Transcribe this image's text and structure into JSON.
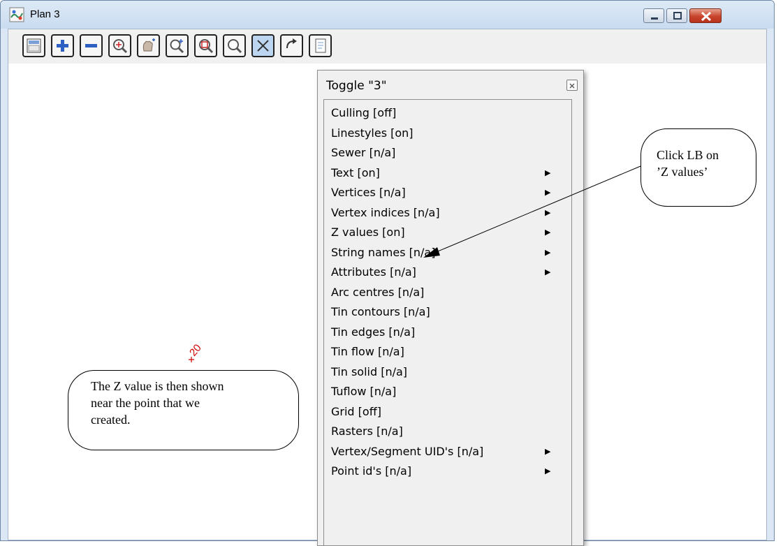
{
  "window": {
    "title": "Plan 3"
  },
  "toolbar": {
    "buttons": [
      "layout-icon",
      "zoom-in-plus-icon",
      "zoom-out-minus-icon",
      "zoom-extent-icon",
      "pan-hand-icon",
      "zoom-plus-icon",
      "zoom-window-icon",
      "zoom-search-icon",
      "toggle-icon",
      "undo-icon",
      "page-icon"
    ]
  },
  "canvas": {
    "point_label": "20"
  },
  "popup": {
    "title": "Toggle \"3\"",
    "items": [
      {
        "label": "Culling [off]",
        "submenu": false
      },
      {
        "label": "Linestyles [on]",
        "submenu": false
      },
      {
        "label": "Sewer [n/a]",
        "submenu": false
      },
      {
        "label": "Text [on]",
        "submenu": true
      },
      {
        "label": "Vertices [n/a]",
        "submenu": true
      },
      {
        "label": "Vertex indices [n/a]",
        "submenu": true
      },
      {
        "label": "Z values [on]",
        "submenu": true
      },
      {
        "label": "String names [n/a]",
        "submenu": true
      },
      {
        "label": "Attributes [n/a]",
        "submenu": true
      },
      {
        "label": "Arc centres [n/a]",
        "submenu": false
      },
      {
        "label": "Tin contours [n/a]",
        "submenu": false
      },
      {
        "label": "Tin edges [n/a]",
        "submenu": false
      },
      {
        "label": "Tin flow [n/a]",
        "submenu": false
      },
      {
        "label": "Tin solid [n/a]",
        "submenu": false
      },
      {
        "label": "Tuflow [n/a]",
        "submenu": false
      },
      {
        "label": "Grid [off]",
        "submenu": false
      },
      {
        "label": "Rasters [n/a]",
        "submenu": false
      },
      {
        "label": "Vertex/Segment UID's [n/a]",
        "submenu": true
      },
      {
        "label": "Point id's [n/a]",
        "submenu": true
      }
    ]
  },
  "callouts": {
    "click_lb": {
      "line1": "Click LB on",
      "line2": "’Z values’"
    },
    "z_value": {
      "line1": "The Z value is then shown",
      "line2": "near the point that we",
      "line3": "created."
    }
  },
  "colors": {
    "point": "#d00000",
    "close_button": "#c8452c"
  }
}
